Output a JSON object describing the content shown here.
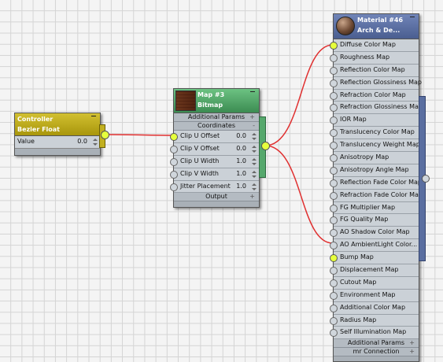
{
  "controller": {
    "title1": "Controller",
    "title2": "Bezier Float",
    "row_label": "Value",
    "row_value": "0.0"
  },
  "bitmap": {
    "title1": "Map #3",
    "title2": "Bitmap",
    "section_top": "Additional Params",
    "section_coords": "Coordinates",
    "section_output": "Output",
    "rows": [
      {
        "label": "Clip U Offset",
        "value": "0.0"
      },
      {
        "label": "Clip V Offset",
        "value": "0.0"
      },
      {
        "label": "Clip U Width",
        "value": "1.0"
      },
      {
        "label": "Clip V Width",
        "value": "1.0"
      },
      {
        "label": "Jitter Placement",
        "value": "1.0"
      }
    ]
  },
  "material": {
    "title1": "Material #46",
    "title2": "Arch & De...",
    "maps": [
      "Diffuse Color Map",
      "Roughness Map",
      "Reflection Color Map",
      "Reflection Glossiness Map",
      "Refraction Color Map",
      "Refraction Glossiness Map",
      "IOR Map",
      "Translucency Color Map",
      "Translucency Weight Map",
      "Anisotropy Map",
      "Anisotropy Angle Map",
      "Reflection Fade Color Map",
      "Refraction Fade Color Map",
      "FG Multiplier Map",
      "FG Quality Map",
      "AO Shadow Color Map",
      "AO AmbientLight Color...",
      "Bump Map",
      "Displacement Map",
      "Cutout Map",
      "Environment Map",
      "Additional Color Map",
      "Radius Map",
      "Self Illumination Map"
    ],
    "section_params": "Additional Params",
    "section_mr": "mr Connection"
  },
  "colors": {
    "controller_header": "#b9a618",
    "bitmap_header": "#4a9a60",
    "material_header": "#5a6ea0",
    "wire": "#e03030",
    "socket_active": "#e6ff3c"
  }
}
